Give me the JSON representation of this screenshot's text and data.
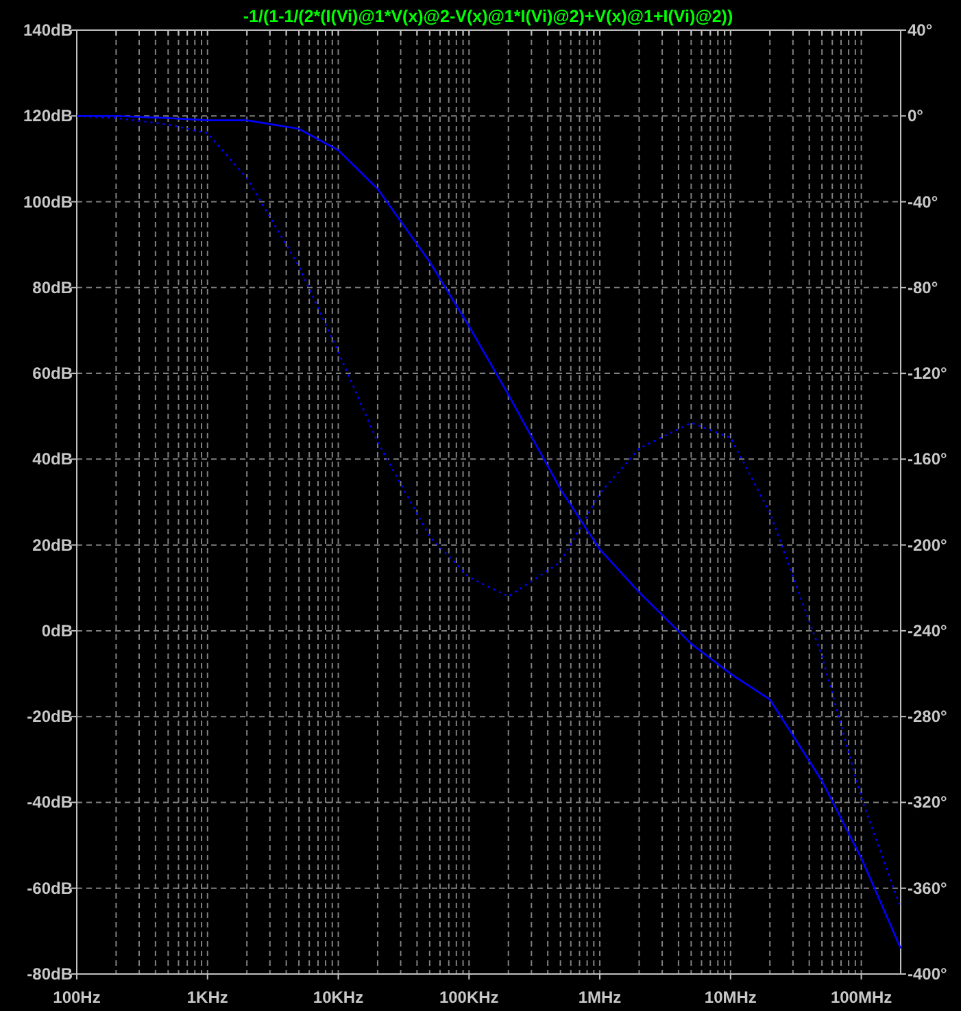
{
  "chart_data": {
    "type": "line",
    "title": "-1/(1-1/(2*(I(Vi)@1*V(x)@2-V(x)@1*I(Vi)@2)+V(x)@1+I(Vi)@2))",
    "categories": [
      "100Hz",
      null,
      null,
      "1KHz",
      null,
      null,
      "10KHz",
      null,
      null,
      "100KHz",
      null,
      null,
      "1MHz",
      null,
      null,
      "10MHz",
      null,
      null,
      "100MHz",
      null
    ],
    "grid": true,
    "ylim": [
      -80,
      140
    ],
    "yticks": [
      {
        "value": 140,
        "label": "140dB"
      },
      {
        "value": 120,
        "label": "120dB"
      },
      {
        "value": 100,
        "label": "100dB"
      },
      {
        "value": 80,
        "label": "80dB"
      },
      {
        "value": 60,
        "label": "60dB"
      },
      {
        "value": 40,
        "label": "40dB"
      },
      {
        "value": 20,
        "label": "20dB"
      },
      {
        "value": 0,
        "label": "0dB"
      },
      {
        "value": -20,
        "label": "-20dB"
      },
      {
        "value": -40,
        "label": "-40dB"
      },
      {
        "value": -60,
        "label": "-60dB"
      },
      {
        "value": -80,
        "label": "-80dB"
      }
    ],
    "y2lim": [
      -400,
      40
    ],
    "y2ticks": [
      {
        "value": 40,
        "label": "40°"
      },
      {
        "value": 0,
        "label": "0°"
      },
      {
        "value": -40,
        "label": "-40°"
      },
      {
        "value": -80,
        "label": "-80°"
      },
      {
        "value": -120,
        "label": "-120°"
      },
      {
        "value": -160,
        "label": "-160°"
      },
      {
        "value": -200,
        "label": "-200°"
      },
      {
        "value": -240,
        "label": "-240°"
      },
      {
        "value": -280,
        "label": "-280°"
      },
      {
        "value": -320,
        "label": "-320°"
      },
      {
        "value": -360,
        "label": "-360°"
      },
      {
        "value": -400,
        "label": "-400°"
      }
    ],
    "series": [
      {
        "color": "#0000ff",
        "values": [
          120,
          120,
          119.5,
          119,
          119,
          117,
          112,
          103,
          86,
          71,
          55,
          33,
          19,
          9,
          -3,
          -10,
          -16,
          -35,
          -53,
          -74
        ]
      },
      {
        "color": "#0000ff",
        "axis": "y2",
        "line_style": "dotted",
        "values": [
          0,
          -1,
          -4,
          -8,
          -29,
          -70,
          -110,
          -152,
          -196,
          -215,
          -224,
          -208,
          -176,
          -155,
          -143,
          -150,
          -185,
          -252,
          -318,
          -369
        ]
      }
    ]
  }
}
